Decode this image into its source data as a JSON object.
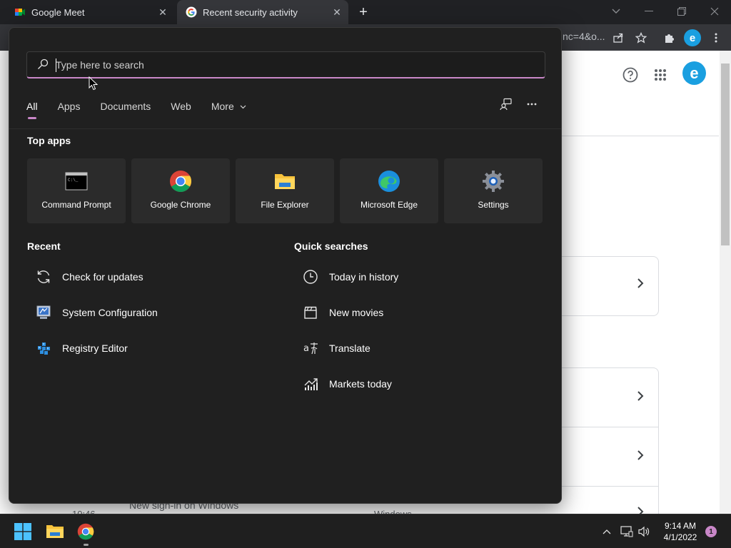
{
  "browser": {
    "tabs": [
      {
        "title": "Google Meet",
        "active": false
      },
      {
        "title": "Recent security activity",
        "active": true
      }
    ],
    "new_tab_symbol": "+",
    "close_symbol": "✕",
    "url_fragment": "nc=4&o...",
    "profile_initial": "e"
  },
  "page": {
    "avatar_initial": "e",
    "bottom_time": "10:46",
    "bottom_title": "New sign-in on Windows",
    "bottom_device": "Windows"
  },
  "search": {
    "placeholder": "Type here to search",
    "value": ""
  },
  "filters": [
    {
      "label": "All",
      "active": true
    },
    {
      "label": "Apps",
      "active": false
    },
    {
      "label": "Documents",
      "active": false
    },
    {
      "label": "Web",
      "active": false
    },
    {
      "label": "More",
      "active": false
    }
  ],
  "top_apps": {
    "title": "Top apps",
    "items": [
      {
        "label": "Command Prompt",
        "icon": "command-prompt-icon"
      },
      {
        "label": "Google Chrome",
        "icon": "chrome-icon"
      },
      {
        "label": "File Explorer",
        "icon": "file-explorer-icon"
      },
      {
        "label": "Microsoft Edge",
        "icon": "edge-icon"
      },
      {
        "label": "Settings",
        "icon": "settings-gear-icon"
      }
    ]
  },
  "recent": {
    "title": "Recent",
    "items": [
      {
        "label": "Check for updates",
        "icon": "refresh-icon"
      },
      {
        "label": "System Configuration",
        "icon": "system-config-icon"
      },
      {
        "label": "Registry Editor",
        "icon": "registry-editor-icon"
      }
    ]
  },
  "quick_searches": {
    "title": "Quick searches",
    "items": [
      {
        "label": "Today in history",
        "icon": "clock-icon"
      },
      {
        "label": "New movies",
        "icon": "clapperboard-icon"
      },
      {
        "label": "Translate",
        "icon": "translate-icon"
      },
      {
        "label": "Markets today",
        "icon": "chart-icon"
      }
    ]
  },
  "taskbar": {
    "time": "9:14 AM",
    "date": "4/1/2022",
    "notification_count": "1"
  },
  "colors": {
    "accent": "#c987c8",
    "panel_bg": "#202020",
    "tile_bg": "#2b2b2b",
    "taskbar_bg": "#1f1f1f"
  }
}
